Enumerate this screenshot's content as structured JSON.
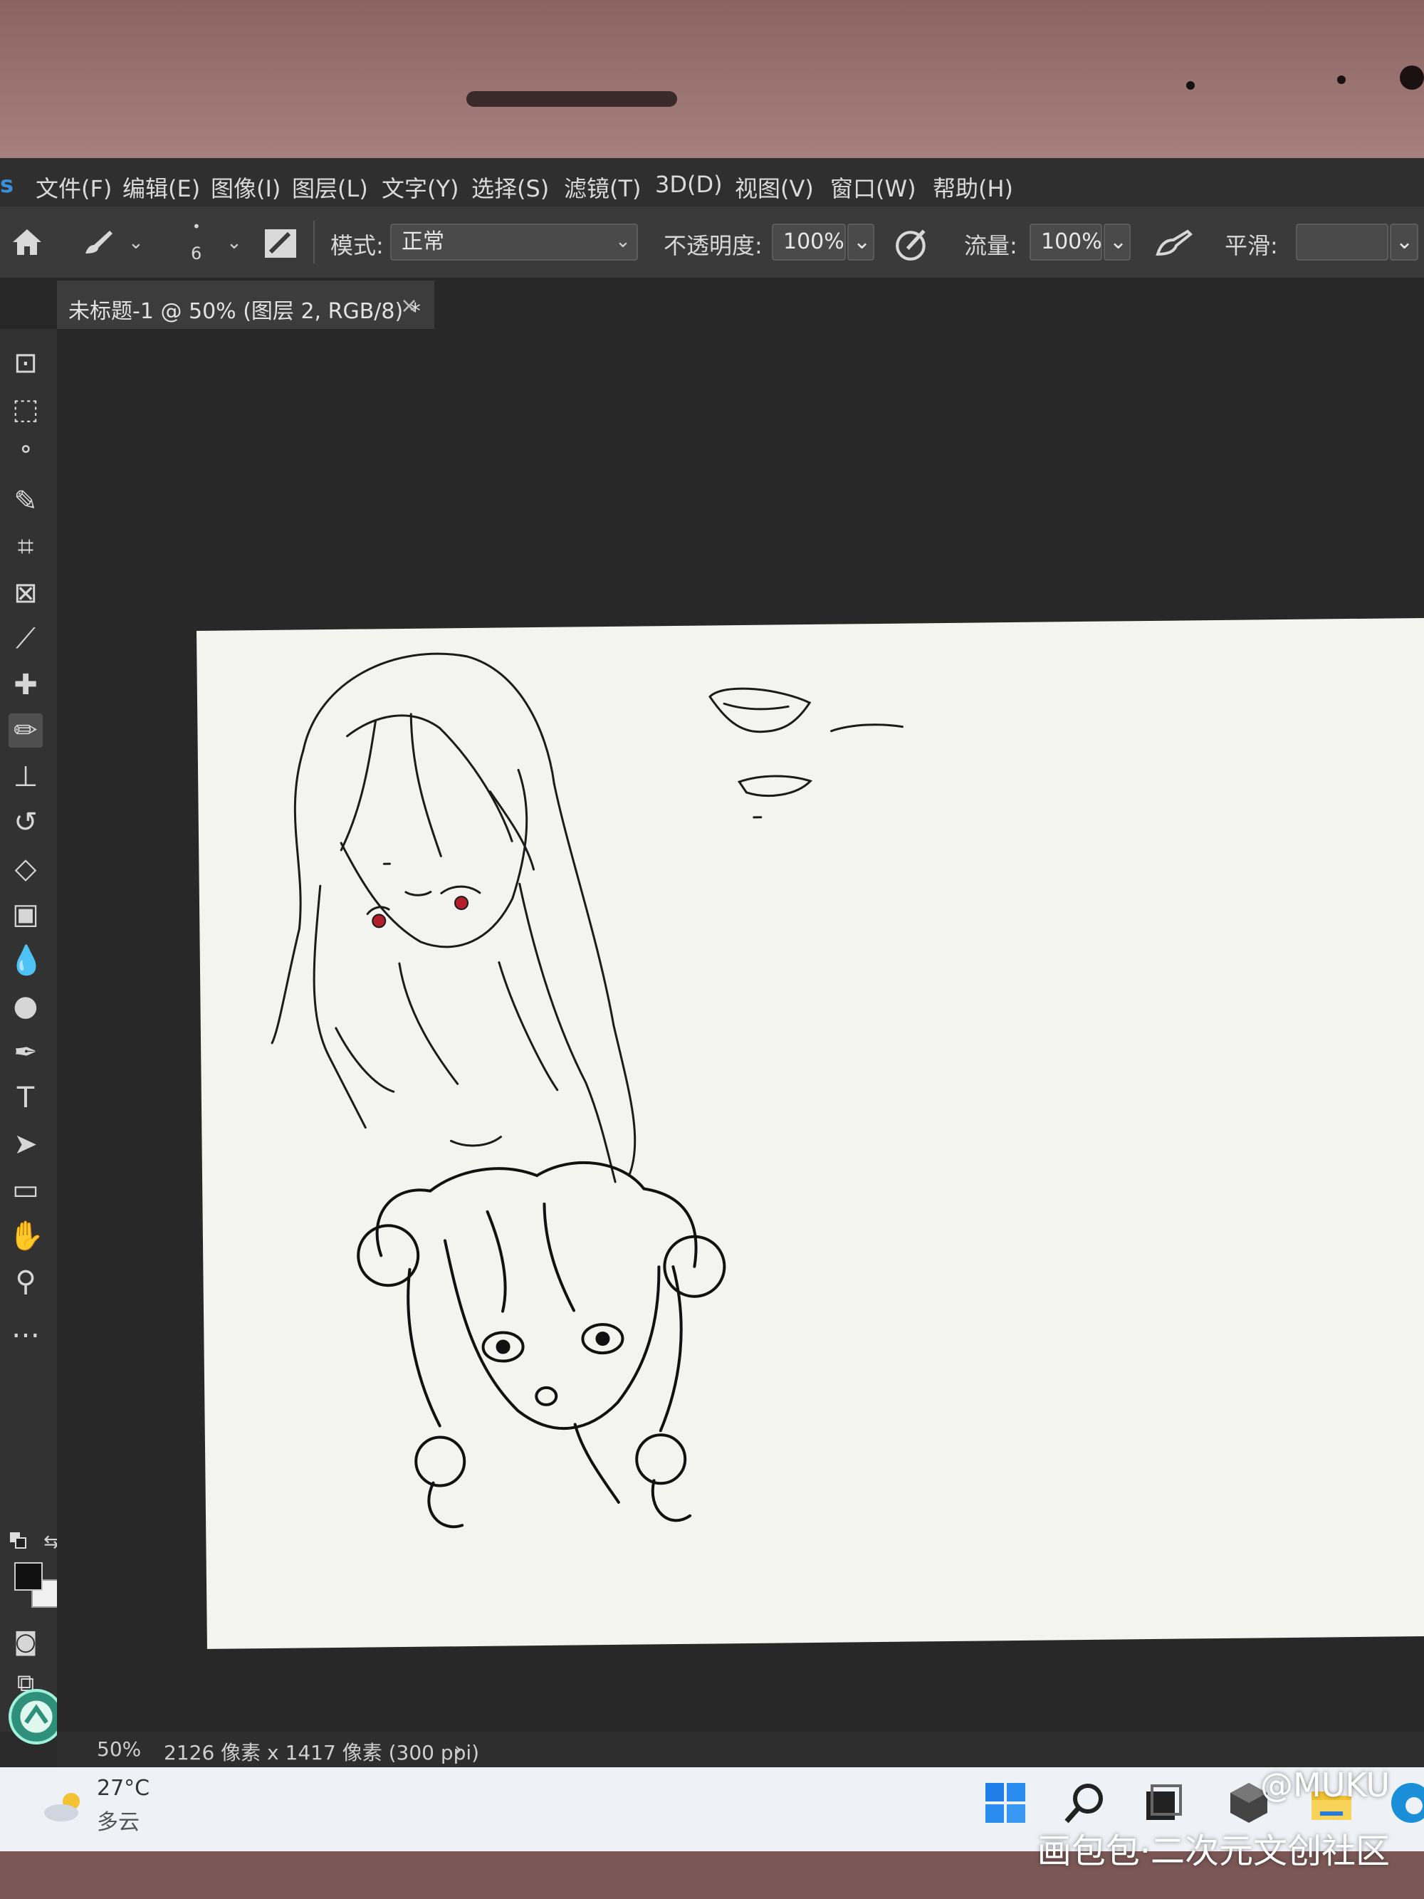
{
  "menubar": {
    "items": [
      "文件(F)",
      "编辑(E)",
      "图像(I)",
      "图层(L)",
      "文字(Y)",
      "选择(S)",
      "滤镜(T)",
      "3D(D)",
      "视图(V)",
      "窗口(W)",
      "帮助(H)"
    ]
  },
  "options": {
    "brush_size": "6",
    "mode_label": "模式:",
    "mode_value": "正常",
    "opacity_label": "不透明度:",
    "opacity_value": "100%",
    "flow_label": "流量:",
    "flow_value": "100%",
    "smoothing_label": "平滑:"
  },
  "document_tab": {
    "title": "未标题-1 @ 50% (图层 2, RGB/8) *",
    "close": "×"
  },
  "tools": [
    {
      "name": "artboard-tool-icon",
      "glyph": "⊡"
    },
    {
      "name": "marquee-tool-icon",
      "glyph": "⬚"
    },
    {
      "name": "lasso-tool-icon",
      "glyph": "ᐤ"
    },
    {
      "name": "quick-select-tool-icon",
      "glyph": "✎"
    },
    {
      "name": "crop-tool-icon",
      "glyph": "⌗"
    },
    {
      "name": "frame-tool-icon",
      "glyph": "⊠"
    },
    {
      "name": "eyedropper-tool-icon",
      "glyph": "⟋"
    },
    {
      "name": "healing-brush-tool-icon",
      "glyph": "✚"
    },
    {
      "name": "brush-tool-icon",
      "glyph": "✏",
      "active": true
    },
    {
      "name": "clone-stamp-tool-icon",
      "glyph": "⊥"
    },
    {
      "name": "history-brush-tool-icon",
      "glyph": "↺"
    },
    {
      "name": "eraser-tool-icon",
      "glyph": "◇"
    },
    {
      "name": "gradient-tool-icon",
      "glyph": "▣"
    },
    {
      "name": "blur-tool-icon",
      "glyph": "💧"
    },
    {
      "name": "dodge-tool-icon",
      "glyph": "●"
    },
    {
      "name": "pen-tool-icon",
      "glyph": "✒"
    },
    {
      "name": "type-tool-icon",
      "glyph": "T"
    },
    {
      "name": "path-selection-tool-icon",
      "glyph": "➤"
    },
    {
      "name": "rectangle-tool-icon",
      "glyph": "▭"
    },
    {
      "name": "hand-tool-icon",
      "glyph": "✋"
    },
    {
      "name": "zoom-tool-icon",
      "glyph": "⚲"
    },
    {
      "name": "more-tools-icon",
      "glyph": "…"
    }
  ],
  "status": {
    "zoom": "50%",
    "doc_info": "2126 像素 x 1417 像素 (300 ppi)",
    "arrow": "›"
  },
  "taskbar": {
    "temperature": "27°C",
    "weather": "多云"
  },
  "watermark": {
    "handle": "@MUKU",
    "community": "画包包·二次元文创社区"
  },
  "colors": {
    "menubar_bg": "#2f2f2f",
    "canvas_bg": "#f3f3f0",
    "eye_red": "#b21e2a",
    "foreground": "#111111",
    "background": "#f0f0f0"
  }
}
